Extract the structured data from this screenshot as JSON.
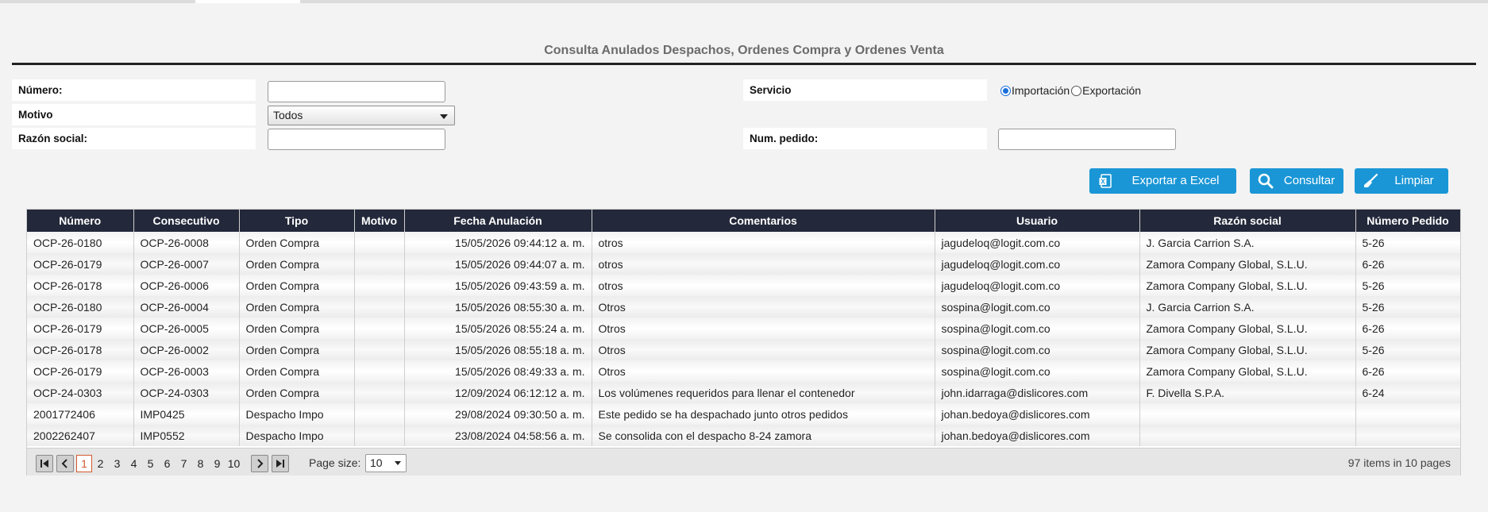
{
  "page": {
    "title": "Consulta Anulados Despachos, Ordenes Compra y Ordenes Venta"
  },
  "form": {
    "numero_label": "Número:",
    "numero_value": "",
    "motivo_label": "Motivo",
    "motivo_selected": "Todos",
    "razon_label": "Razón social:",
    "razon_value": "",
    "servicio_label": "Servicio",
    "servicio_options": [
      "Importación",
      "Exportación"
    ],
    "servicio_selected": "Importación",
    "pedido_label": "Num. pedido:",
    "pedido_value": ""
  },
  "actions": {
    "export_label": "Exportar a Excel",
    "consult_label": "Consultar",
    "clear_label": "Limpiar"
  },
  "table": {
    "columns": [
      "Número",
      "Consecutivo",
      "Tipo",
      "Motivo",
      "Fecha Anulación",
      "Comentarios",
      "Usuario",
      "Razón social",
      "Número Pedido"
    ],
    "rows": [
      [
        "OCP-26-0180",
        "OCP-26-0008",
        "Orden Compra",
        "",
        "15/05/2026 09:44:12 a. m.",
        "otros",
        "jagudeloq@logit.com.co",
        "J. Garcia Carrion S.A.",
        "5-26"
      ],
      [
        "OCP-26-0179",
        "OCP-26-0007",
        "Orden Compra",
        "",
        "15/05/2026 09:44:07 a. m.",
        "otros",
        "jagudeloq@logit.com.co",
        "Zamora Company Global, S.L.U.",
        "6-26"
      ],
      [
        "OCP-26-0178",
        "OCP-26-0006",
        "Orden Compra",
        "",
        "15/05/2026 09:43:59 a. m.",
        "otros",
        "jagudeloq@logit.com.co",
        "Zamora Company Global, S.L.U.",
        "5-26"
      ],
      [
        "OCP-26-0180",
        "OCP-26-0004",
        "Orden Compra",
        "",
        "15/05/2026 08:55:30 a. m.",
        "Otros",
        "sospina@logit.com.co",
        "J. Garcia Carrion S.A.",
        "5-26"
      ],
      [
        "OCP-26-0179",
        "OCP-26-0005",
        "Orden Compra",
        "",
        "15/05/2026 08:55:24 a. m.",
        "Otros",
        "sospina@logit.com.co",
        "Zamora Company Global, S.L.U.",
        "6-26"
      ],
      [
        "OCP-26-0178",
        "OCP-26-0002",
        "Orden Compra",
        "",
        "15/05/2026 08:55:18 a. m.",
        "Otros",
        "sospina@logit.com.co",
        "Zamora Company Global, S.L.U.",
        "5-26"
      ],
      [
        "OCP-26-0179",
        "OCP-26-0003",
        "Orden Compra",
        "",
        "15/05/2026 08:49:33 a. m.",
        "Otros",
        "sospina@logit.com.co",
        "Zamora Company Global, S.L.U.",
        "6-26"
      ],
      [
        "OCP-24-0303",
        "OCP-24-0303",
        "Orden Compra",
        "",
        "12/09/2024 06:12:12 a. m.",
        "Los volúmenes requeridos para llenar el contenedor",
        "john.idarraga@dislicores.com",
        "F. Divella S.P.A.",
        "6-24"
      ],
      [
        "2001772406",
        "IMP0425",
        "Despacho Impo",
        "",
        "29/08/2024 09:30:50 a. m.",
        "Este pedido se ha despachado junto otros pedidos",
        "johan.bedoya@dislicores.com",
        "",
        ""
      ],
      [
        "2002262407",
        "IMP0552",
        "Despacho Impo",
        "",
        "23/08/2024 04:58:56 a. m.",
        "Se consolida con el despacho 8-24 zamora",
        "johan.bedoya@dislicores.com",
        "",
        ""
      ]
    ]
  },
  "pager": {
    "pages": [
      "1",
      "2",
      "3",
      "4",
      "5",
      "6",
      "7",
      "8",
      "9",
      "10"
    ],
    "current_page": "1",
    "page_size_label": "Page size:",
    "page_size": "10",
    "info": "97 items in 10 pages"
  }
}
